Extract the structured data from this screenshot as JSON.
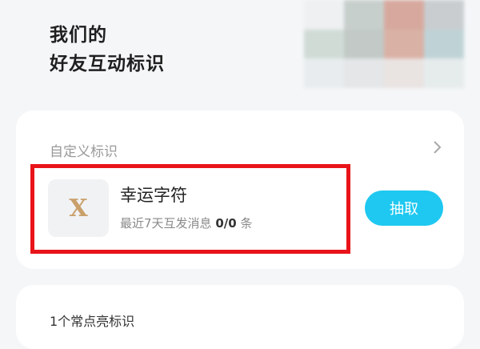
{
  "header": {
    "line1": "我们的",
    "line2": "好友互动标识"
  },
  "mosaic": {
    "colors": [
      "#eef0f2",
      "#c7cfcc",
      "#d7a99e",
      "#c9cdd0",
      "#d0dbd6",
      "#c2c9c6",
      "#d9b1a5",
      "#bfd3d6",
      "#e8ecee",
      "#e4e6e8",
      "#e9e3e2",
      "#e6ebec"
    ]
  },
  "custom_section": {
    "label": "自定义标识",
    "item": {
      "icon_char": "X",
      "title": "幸运字符",
      "subtitle_prefix": "最近7天互发消息",
      "count": "0/0",
      "unit": "条",
      "action_label": "抽取"
    }
  },
  "next_section": {
    "label": "1个常点亮标识"
  },
  "colors": {
    "accent": "#1ec8f0",
    "highlight": "#e8141a"
  }
}
